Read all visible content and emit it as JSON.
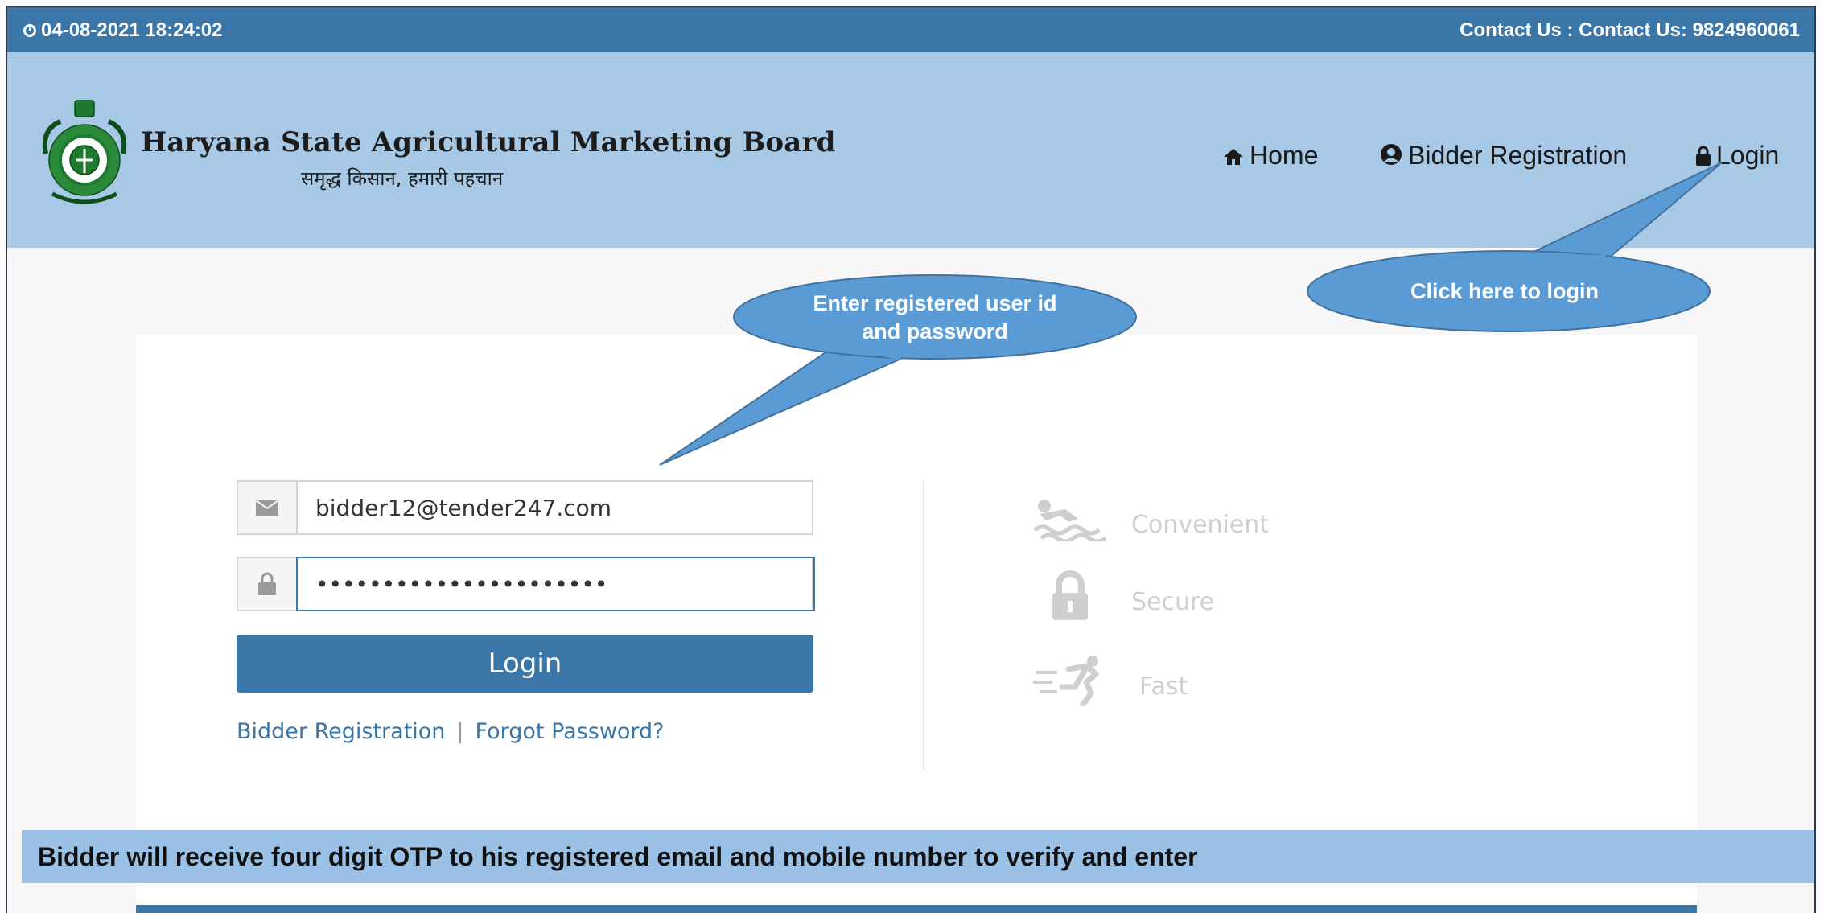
{
  "topbar": {
    "datetime": "04-08-2021 18:24:02",
    "contact": "Contact Us : Contact Us: 9824960061"
  },
  "brand": {
    "title": "Haryana State Agricultural Marketing Board",
    "tagline": "समृद्ध किसान, हमारी पहचान"
  },
  "nav": {
    "home": "Home",
    "bidder_registration": "Bidder Registration",
    "login": "Login"
  },
  "login_form": {
    "email_value": "bidder12@tender247.com",
    "password_value": "••••••••••••••••••••••",
    "submit_label": "Login",
    "bidder_registration_link": "Bidder Registration",
    "separator": "|",
    "forgot_password_link": "Forgot Password?"
  },
  "features": [
    {
      "label": "Convenient",
      "icon": "swimmer-icon"
    },
    {
      "label": "Secure",
      "icon": "lock-icon"
    },
    {
      "label": "Fast",
      "icon": "running-icon"
    }
  ],
  "callouts": {
    "credentials": "Enter registered user id and password",
    "login": "Click here to login"
  },
  "note": "Bidder will receive four digit OTP to his registered email and mobile number to verify and enter",
  "colors": {
    "topbar": "#3a76a8",
    "header": "#a8c9e6",
    "callout": "#5b9bd5",
    "note_bar": "#9bc2e6"
  }
}
